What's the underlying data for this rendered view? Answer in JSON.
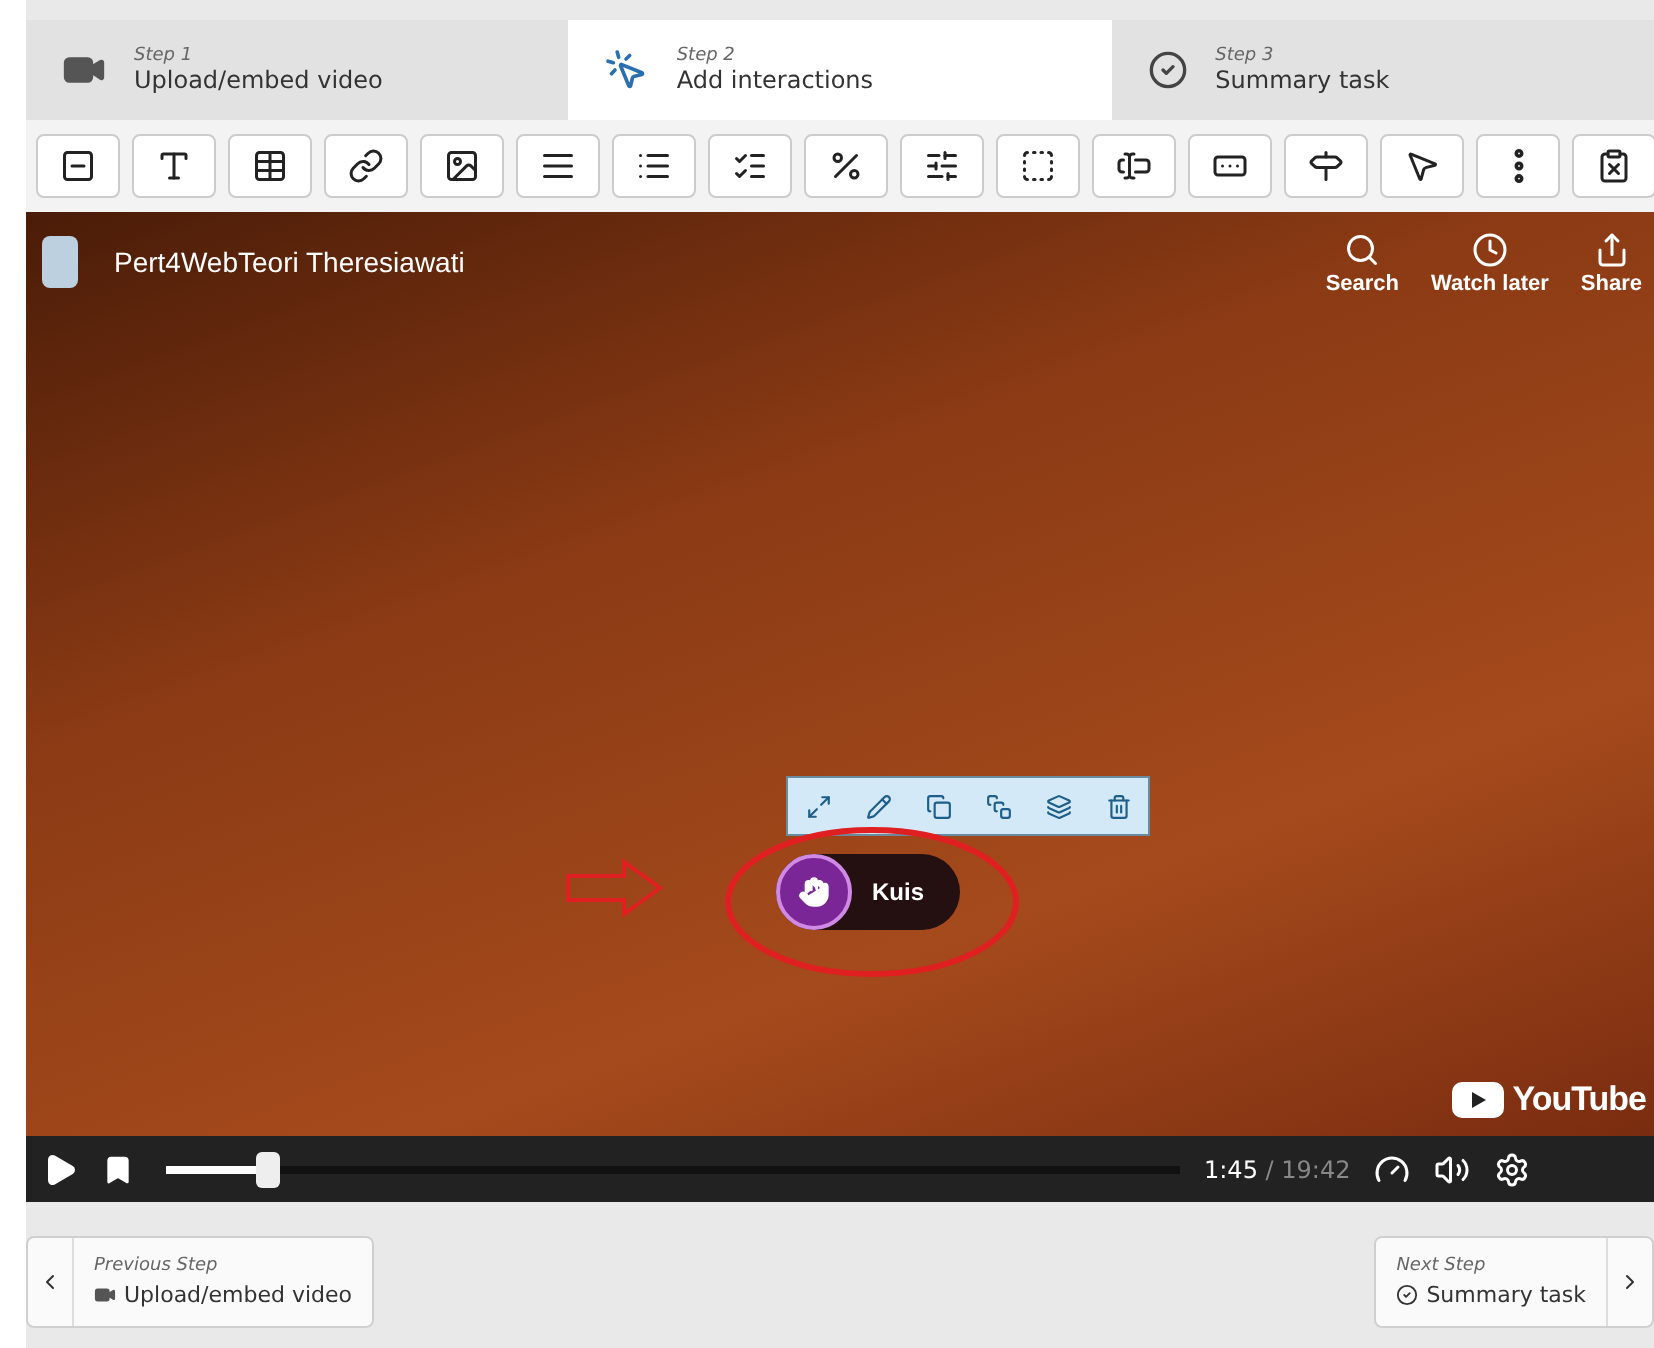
{
  "steps": [
    {
      "step": "Step 1",
      "label": "Upload/embed video",
      "kind": "video",
      "selected": false
    },
    {
      "step": "Step 2",
      "label": "Add interactions",
      "kind": "interact",
      "selected": true
    },
    {
      "step": "Step 3",
      "label": "Summary task",
      "kind": "check",
      "selected": false
    }
  ],
  "video": {
    "channel": "Pert4WebTeori Theresiawati",
    "actions": [
      "Search",
      "Watch later",
      "Share"
    ],
    "brand": "YouTube"
  },
  "interaction": {
    "label": "Kuis"
  },
  "player": {
    "current": "1:45",
    "separator": "/",
    "total": "19:42",
    "level": 0.09
  },
  "footer": {
    "previous": {
      "caption": "Previous Step",
      "label": "Upload/embed video"
    },
    "next": {
      "caption": "Next Step",
      "label": "Summary task"
    }
  }
}
